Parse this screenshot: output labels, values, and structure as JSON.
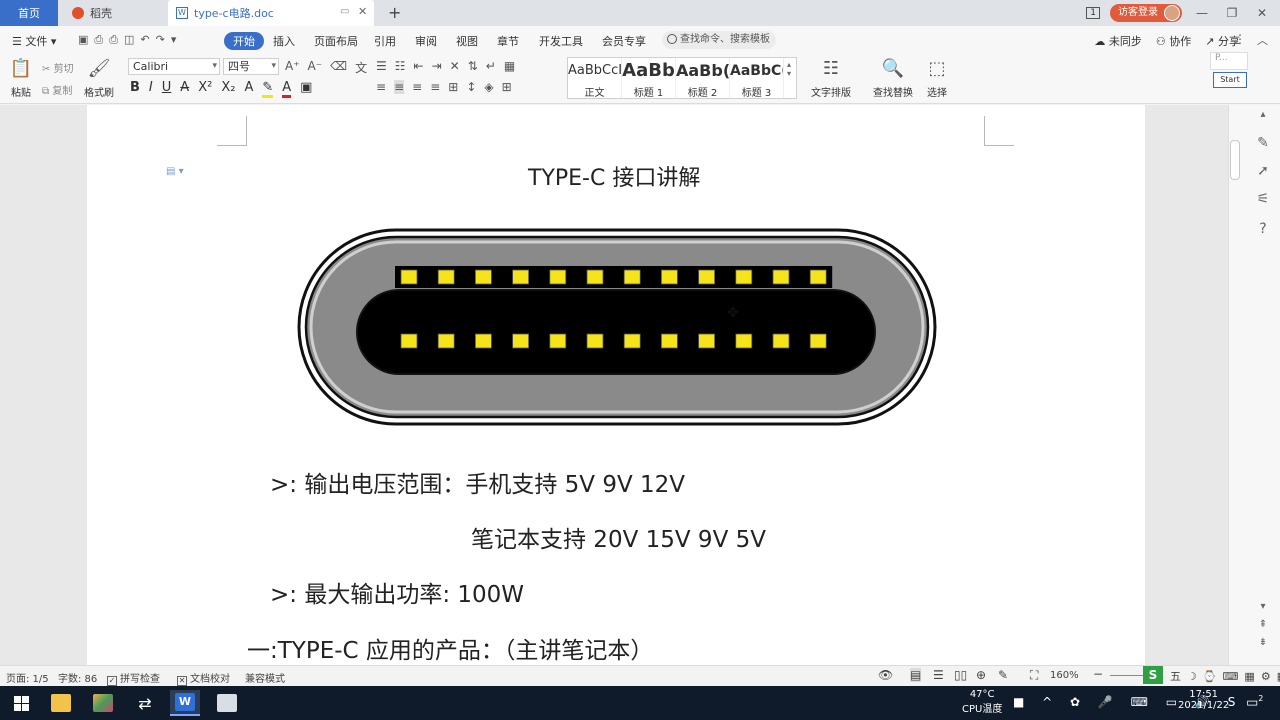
{
  "tabs": [
    {
      "label": "首页"
    },
    {
      "label": "稻壳"
    },
    {
      "label": "type-c电路.doc"
    }
  ],
  "titlebar": {
    "page_indicator": "1",
    "login_label": "访客登录"
  },
  "menu": {
    "file_label": "文件",
    "items": [
      "开始",
      "插入",
      "页面布局",
      "引用",
      "审阅",
      "视图",
      "章节",
      "开发工具",
      "会员专享"
    ],
    "search_placeholder": "查找命令、搜索模板",
    "sync_label": "未同步",
    "collab_label": "协作",
    "share_label": "分享"
  },
  "ribbon": {
    "paste_label": "粘贴",
    "cut_label": "剪切",
    "copy_label": "复制",
    "format_painter_label": "格式刷",
    "font_name": "Calibri",
    "font_size": "四号",
    "styles": [
      {
        "preview": "AaBbCcI",
        "name": "正文"
      },
      {
        "preview": "AaBb",
        "name": "标题 1"
      },
      {
        "preview": "AaBb(",
        "name": "标题 2"
      },
      {
        "preview": "AaBbC(",
        "name": "标题 3"
      }
    ],
    "text_layout_label": "文字排版",
    "find_replace_label": "查找替换",
    "select_label": "选择"
  },
  "mini_panel": {
    "p_label": "P...",
    "start_label": "Start"
  },
  "document": {
    "title": "TYPE-C 接口讲解",
    "line1": ">:  输出电压范围：手机支持 5V 9V 12V",
    "line2": "笔记本支持 20V 15V 9V 5V",
    "line3": ">:  最大输出功率: 100W",
    "line4": "一:TYPE-C 应用的产品：（主讲笔记本）",
    "connector_pins_per_row": 12,
    "connector_rows": 2
  },
  "statusbar": {
    "page": "页面: 1/5",
    "words": "字数: 86",
    "spell": "拼写检查",
    "proof": "文档校对",
    "compat": "兼容模式",
    "zoom": "160%"
  },
  "taskbar": {
    "temperature": "47°C",
    "temp_label": "CPU温度",
    "time": "17:51",
    "date": "2021/1/22",
    "notification_count": "2"
  },
  "colors": {
    "accent": "#3a6fc9",
    "pin": "#f5e41a",
    "connector_shell": "#808080"
  }
}
